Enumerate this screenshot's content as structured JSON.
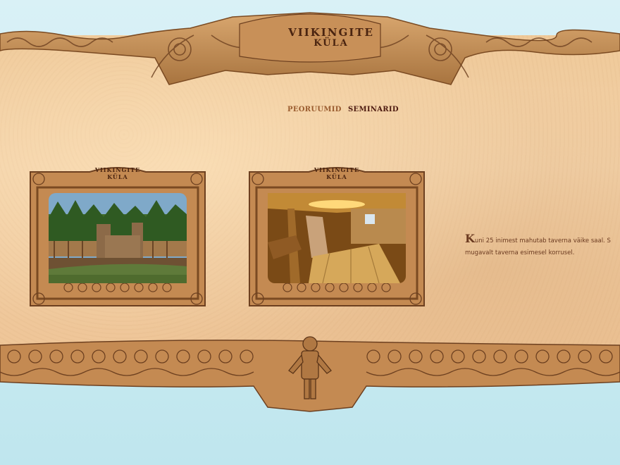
{
  "logo": {
    "line1": "VIIKINGITE",
    "line2": "KÜLA"
  },
  "nav": {
    "items": [
      {
        "label": "PEORUUMID"
      },
      {
        "label": "SEMINARID"
      }
    ]
  },
  "gallery": {
    "photos": [
      {
        "icon": "viking-village-fort-photo",
        "logo_line1": "VIIKINGITE",
        "logo_line2": "KÜLA"
      },
      {
        "icon": "tavern-interior-photo",
        "logo_line1": "VIIKINGITE",
        "logo_line2": "KÜLA"
      }
    ]
  },
  "description": {
    "dropcap": "K",
    "line1_rest": "uni 25 inimest mahutab taverna väike saal. S",
    "line2": "mugavalt taverna esimesel korrusel."
  },
  "colors": {
    "sky": "#bfe6ee",
    "parchment": "#f3d2a9",
    "carving": "#b98552",
    "nav_active": "#9a5c2f",
    "nav_link": "#4d1a10"
  }
}
